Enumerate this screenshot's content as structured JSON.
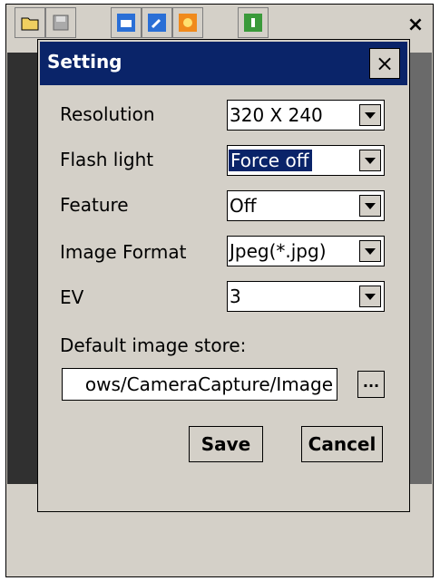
{
  "toolbar": {
    "icons": [
      "folder-icon",
      "save-disk-icon",
      "camera-icon",
      "settings-tool-icon",
      "brightness-icon",
      "help-icon"
    ]
  },
  "app_close": "×",
  "dialog": {
    "title": "Setting",
    "close_label": "×",
    "fields": {
      "resolution": {
        "label": "Resolution",
        "value": "320 X 240"
      },
      "flash": {
        "label": "Flash light",
        "value": "Force off"
      },
      "feature": {
        "label": "Feature",
        "value": "Off"
      },
      "image_format": {
        "label": "Image Format",
        "value": "Jpeg(*.jpg)"
      },
      "ev": {
        "label": "EV",
        "value": "3"
      }
    },
    "store": {
      "label": "Default image store:",
      "value": "ows/CameraCapture/Image",
      "browse_label": "..."
    },
    "save_label": "Save",
    "cancel_label": "Cancel"
  },
  "colors": {
    "title_bg": "#0a2469",
    "panel": "#d4d0c8",
    "selected": "#0a2469"
  }
}
